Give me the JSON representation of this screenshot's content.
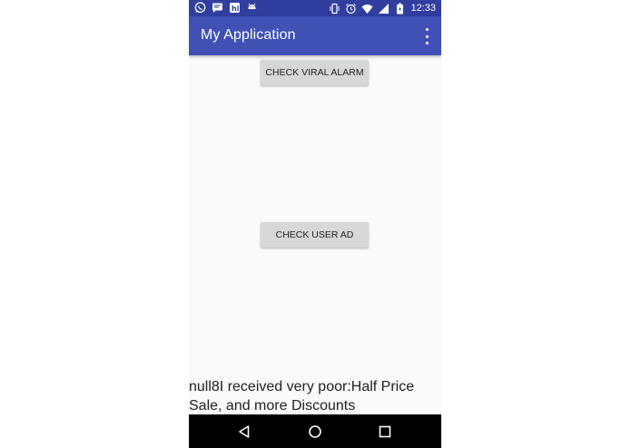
{
  "status_bar": {
    "time": "12:33",
    "left_icons": [
      "whatsapp-icon",
      "message-icon",
      "hike-icon",
      "android-icon"
    ],
    "right_icons": [
      "vibrate-icon",
      "alarm-icon",
      "wifi-icon",
      "signal-icon",
      "battery-icon"
    ]
  },
  "app_bar": {
    "title": "My Application",
    "menu_icon": "overflow-menu-icon"
  },
  "buttons": {
    "check_viral_alarm": "CHECK VIRAL ALARM",
    "check_user_ad": "CHECK USER AD"
  },
  "message": "null8I received very poor:Half Price Sale, and more Discounts",
  "nav_bar": {
    "icons": [
      "back-icon",
      "home-icon",
      "recents-icon"
    ]
  },
  "colors": {
    "status_bar": "#303f9f",
    "app_bar": "#3f51b5",
    "button": "#d6d7d7",
    "background": "#fafafa",
    "nav_bar": "#000000"
  }
}
